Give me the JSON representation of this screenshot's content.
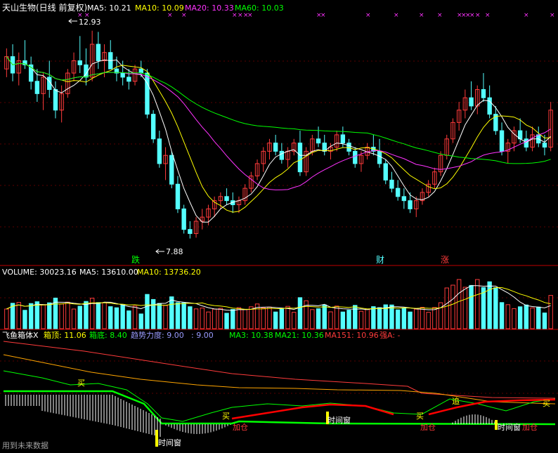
{
  "price_header": {
    "title": "天山生物(日线 前复权)",
    "ma5": "MA5: 10.21",
    "ma10": "MA10: 10.09",
    "ma20": "MA20: 10.33",
    "ma60": "MA60: 10.03"
  },
  "volume_header": {
    "volume": "VOLUME: 30023.16",
    "ma5": "MA5: 13610.00",
    "ma10": "MA10: 13736.20"
  },
  "indicator_header": {
    "name": "飞鱼箱体X",
    "top": "箱顶: 11.06",
    "bottom": "箱底: 8.40",
    "trend": "趋势力度: 9.00",
    "trend2": ": 9.00",
    "ma3": "MA3: 10.38",
    "ma21": "MA21: 10.36",
    "ma151": "MA151: 10.96",
    "strong": "强A: -"
  },
  "annotations": {
    "high_label": "12.93",
    "low_label": "7.88",
    "die": "跌",
    "cai": "财",
    "zhang": "涨",
    "mai": "买",
    "jiacang": "加仓",
    "shijianchuang": "时间窗",
    "zhui": "追"
  },
  "footer": {
    "note": "用到未来数据"
  },
  "colors": {
    "up": "#ff3b3b",
    "down": "#54ffff",
    "ma5": "#ffffff",
    "ma10": "#ffff00",
    "ma20": "#ff33ff",
    "ma60": "#00ff00",
    "axis": "#c00000"
  },
  "chart_data": [
    {
      "type": "candlestick",
      "title": "天山生物(日线 前复权)",
      "price_labels": {
        "high": 12.93,
        "low": 7.88
      },
      "series": [
        {
          "name": "MA5",
          "last": 10.21
        },
        {
          "name": "MA10",
          "last": 10.09
        },
        {
          "name": "MA20",
          "last": 10.33
        },
        {
          "name": "MA60",
          "last": 10.03
        }
      ],
      "ohlc": [
        [
          12.0,
          12.5,
          11.8,
          12.3
        ],
        [
          12.3,
          12.6,
          11.7,
          11.9
        ],
        [
          11.9,
          12.4,
          11.6,
          12.2
        ],
        [
          12.2,
          12.7,
          12.0,
          12.1
        ],
        [
          12.1,
          12.3,
          11.5,
          11.7
        ],
        [
          11.7,
          12.0,
          11.2,
          11.4
        ],
        [
          11.4,
          11.9,
          11.0,
          11.8
        ],
        [
          11.8,
          12.2,
          11.3,
          11.5
        ],
        [
          11.5,
          11.7,
          10.8,
          11.0
        ],
        [
          11.0,
          11.6,
          10.7,
          11.4
        ],
        [
          11.4,
          12.0,
          11.3,
          11.9
        ],
        [
          11.9,
          12.4,
          11.7,
          12.2
        ],
        [
          12.2,
          12.8,
          11.9,
          12.1
        ],
        [
          12.1,
          12.5,
          11.6,
          11.8
        ],
        [
          11.8,
          12.93,
          11.7,
          12.6
        ],
        [
          12.6,
          12.9,
          12.0,
          12.2
        ],
        [
          12.2,
          12.6,
          11.8,
          12.4
        ],
        [
          12.4,
          12.7,
          12.0,
          12.0
        ],
        [
          12.0,
          12.3,
          11.7,
          11.9
        ],
        [
          11.9,
          12.2,
          11.6,
          11.8
        ],
        [
          11.8,
          12.0,
          11.5,
          11.7
        ],
        [
          11.7,
          12.1,
          11.6,
          12.0
        ],
        [
          12.0,
          12.2,
          11.8,
          11.9
        ],
        [
          11.9,
          12.0,
          10.8,
          10.9
        ],
        [
          10.9,
          11.0,
          10.2,
          10.3
        ],
        [
          10.3,
          10.5,
          9.6,
          9.7
        ],
        [
          9.7,
          10.1,
          9.3,
          9.9
        ],
        [
          9.9,
          10.0,
          9.1,
          9.2
        ],
        [
          9.2,
          9.4,
          8.5,
          8.6
        ],
        [
          8.6,
          8.7,
          8.0,
          8.1
        ],
        [
          8.1,
          8.3,
          7.88,
          8.0
        ],
        [
          8.0,
          8.4,
          7.9,
          8.3
        ],
        [
          8.3,
          8.6,
          8.1,
          8.4
        ],
        [
          8.4,
          8.7,
          8.2,
          8.6
        ],
        [
          8.6,
          8.9,
          8.4,
          8.8
        ],
        [
          8.8,
          9.0,
          8.6,
          8.9
        ],
        [
          8.9,
          9.1,
          8.7,
          8.8
        ],
        [
          8.8,
          9.0,
          8.5,
          8.7
        ],
        [
          8.7,
          8.9,
          8.5,
          8.8
        ],
        [
          8.8,
          9.2,
          8.7,
          9.1
        ],
        [
          9.1,
          9.5,
          9.0,
          9.4
        ],
        [
          9.4,
          9.8,
          9.3,
          9.7
        ],
        [
          9.7,
          10.1,
          9.5,
          10.0
        ],
        [
          10.0,
          10.3,
          9.8,
          10.2
        ],
        [
          10.2,
          10.4,
          9.9,
          10.0
        ],
        [
          10.0,
          10.2,
          9.7,
          9.8
        ],
        [
          9.8,
          10.1,
          9.6,
          10.0
        ],
        [
          10.0,
          10.3,
          9.9,
          10.2
        ],
        [
          10.2,
          10.5,
          9.4,
          9.5
        ],
        [
          9.5,
          10.1,
          9.4,
          10.0
        ],
        [
          10.0,
          10.4,
          9.9,
          10.3
        ],
        [
          10.3,
          10.6,
          10.1,
          10.2
        ],
        [
          10.2,
          10.4,
          9.9,
          10.0
        ],
        [
          10.0,
          10.2,
          9.8,
          10.1
        ],
        [
          10.1,
          10.5,
          10.0,
          10.4
        ],
        [
          10.4,
          10.6,
          10.1,
          10.2
        ],
        [
          10.2,
          10.3,
          9.9,
          10.0
        ],
        [
          10.0,
          10.1,
          9.6,
          9.7
        ],
        [
          9.7,
          10.0,
          9.5,
          9.9
        ],
        [
          9.9,
          10.2,
          9.8,
          10.1
        ],
        [
          10.1,
          10.4,
          9.9,
          10.0
        ],
        [
          10.0,
          10.3,
          9.6,
          9.7
        ],
        [
          9.7,
          9.8,
          9.2,
          9.3
        ],
        [
          9.3,
          9.5,
          9.0,
          9.1
        ],
        [
          9.1,
          9.3,
          8.8,
          8.9
        ],
        [
          8.9,
          9.1,
          8.6,
          8.8
        ],
        [
          8.8,
          9.0,
          8.5,
          8.6
        ],
        [
          8.6,
          8.9,
          8.4,
          8.8
        ],
        [
          8.8,
          9.1,
          8.7,
          9.0
        ],
        [
          9.0,
          9.3,
          8.9,
          9.2
        ],
        [
          9.2,
          9.6,
          9.1,
          9.5
        ],
        [
          9.5,
          10.0,
          9.4,
          9.9
        ],
        [
          9.9,
          10.4,
          9.8,
          10.3
        ],
        [
          10.3,
          10.8,
          10.2,
          10.7
        ],
        [
          10.7,
          11.2,
          10.5,
          11.0
        ],
        [
          11.0,
          11.5,
          10.8,
          11.3
        ],
        [
          11.3,
          11.7,
          11.0,
          11.1
        ],
        [
          11.1,
          11.6,
          10.9,
          11.5
        ],
        [
          11.5,
          11.9,
          11.2,
          11.3
        ],
        [
          11.3,
          11.6,
          10.8,
          10.9
        ],
        [
          10.9,
          11.1,
          10.4,
          10.5
        ],
        [
          10.5,
          10.7,
          9.9,
          10.0
        ],
        [
          10.0,
          10.3,
          9.7,
          10.2
        ],
        [
          10.2,
          10.6,
          10.0,
          10.5
        ],
        [
          10.5,
          10.8,
          10.2,
          10.3
        ],
        [
          10.3,
          10.5,
          10.0,
          10.1
        ],
        [
          10.1,
          10.6,
          10.0,
          10.4
        ],
        [
          10.4,
          10.6,
          10.1,
          10.2
        ],
        [
          10.2,
          10.4,
          9.9,
          10.1
        ],
        [
          10.1,
          11.2,
          10.0,
          11.0
        ]
      ]
    }
  ]
}
